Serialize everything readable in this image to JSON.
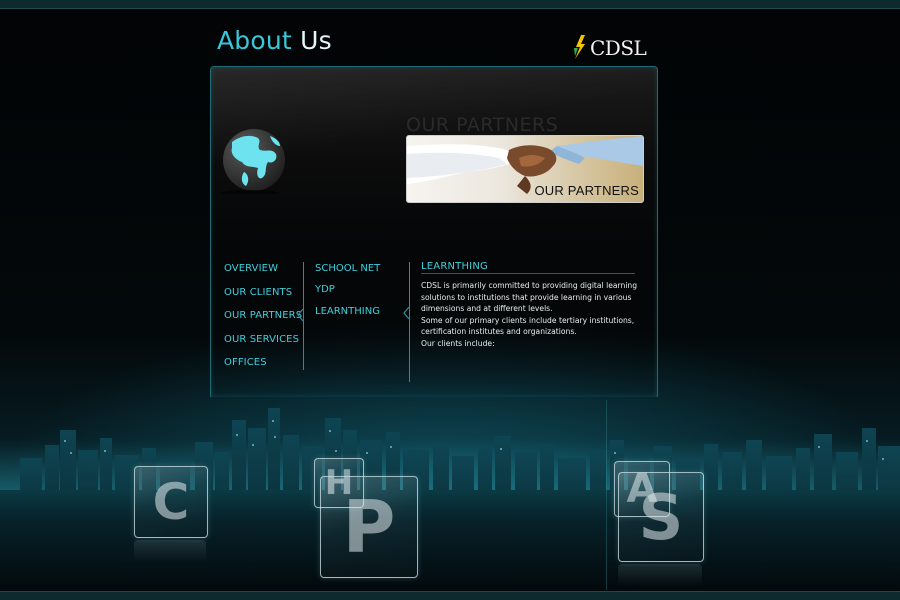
{
  "page": {
    "title_part1": "About",
    "title_part2": "Us"
  },
  "logo": {
    "text": "CDSL"
  },
  "banner": {
    "ghost_heading": "OUR PARTNERS",
    "label": "OUR PARTNERS"
  },
  "nav": {
    "items": [
      {
        "label": "OVERVIEW"
      },
      {
        "label": "OUR CLIENTS"
      },
      {
        "label": "OUR PARTNERS"
      },
      {
        "label": "OUR SERVICES"
      },
      {
        "label": "OFFICES"
      }
    ]
  },
  "subnav": {
    "items": [
      {
        "label": "SCHOOL NET"
      },
      {
        "label": "YDP"
      },
      {
        "label": "LEARNTHING"
      }
    ]
  },
  "content": {
    "heading": "LEARNTHING",
    "paragraph1": "CDSL is primarily committed to providing digital learning solutions to institutions that provide learning in various dimensions and at different levels.",
    "paragraph2": "Some of our primary clients include tertiary institutions, certification institutes and organizations.",
    "paragraph3": "Our clients include:"
  },
  "tiles": [
    {
      "letter": "C"
    },
    {
      "letter": "H"
    },
    {
      "letter": "P"
    },
    {
      "letter": "A"
    },
    {
      "letter": "S"
    }
  ],
  "colors": {
    "accent": "#3fcfdc",
    "title_accent": "#39c8d8",
    "panel_border": "#1f6a73"
  }
}
